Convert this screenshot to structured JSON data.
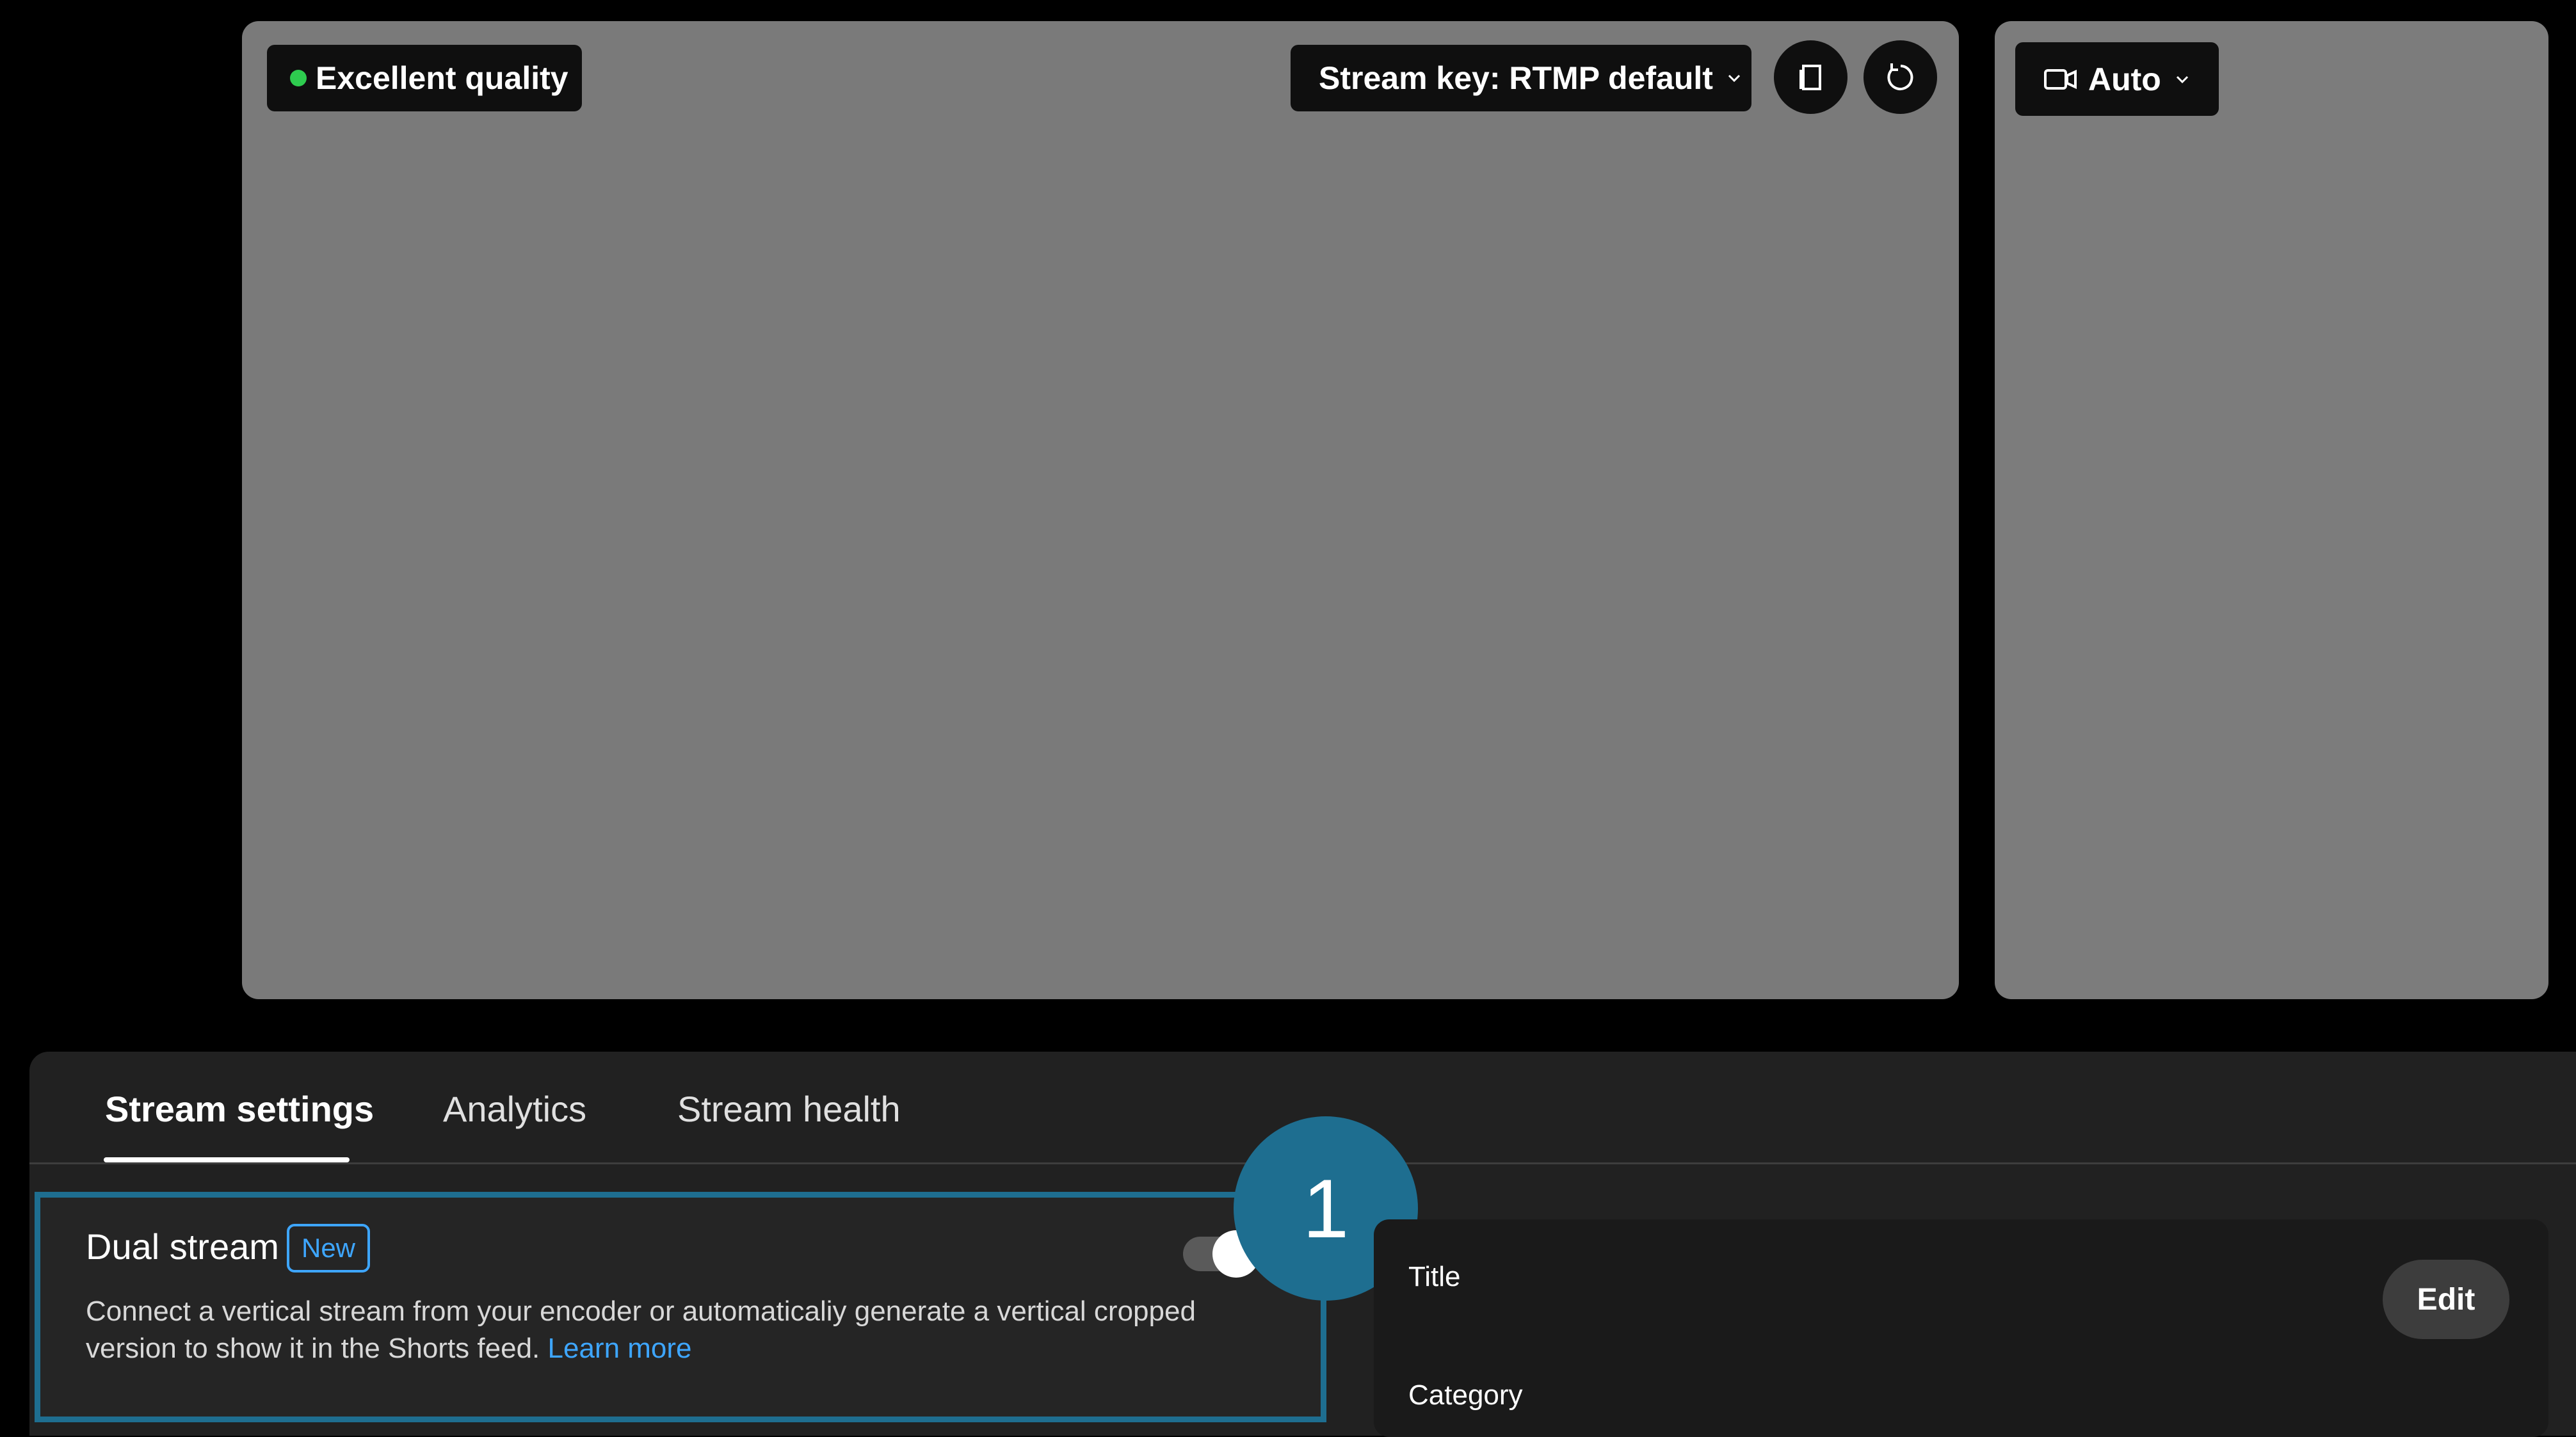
{
  "preview": {
    "quality_label": "Excellent quality",
    "quality_status_color": "#2ecc4f",
    "stream_key_label": "Stream key: RTMP default",
    "copy_icon": "copy-icon",
    "refresh_icon": "refresh-icon",
    "vertical_camera_label": "Auto"
  },
  "tabs": [
    {
      "label": "Stream settings",
      "active": true
    },
    {
      "label": "Analytics",
      "active": false
    },
    {
      "label": "Stream health",
      "active": false
    }
  ],
  "dual_stream": {
    "title": "Dual stream",
    "badge": "New",
    "description": "Connect a vertical stream from your encoder or automaticaliy generate a vertical cropped version to show it in the Shorts feed.",
    "learn_more": "Learn more",
    "toggle_on": true
  },
  "annotation": {
    "step_number": "1",
    "color": "#1e6e90"
  },
  "details": {
    "title_label": "Title",
    "edit_label": "Edit",
    "category_label": "Category"
  },
  "colors": {
    "link": "#3ea6ff",
    "panel": "#212121"
  }
}
